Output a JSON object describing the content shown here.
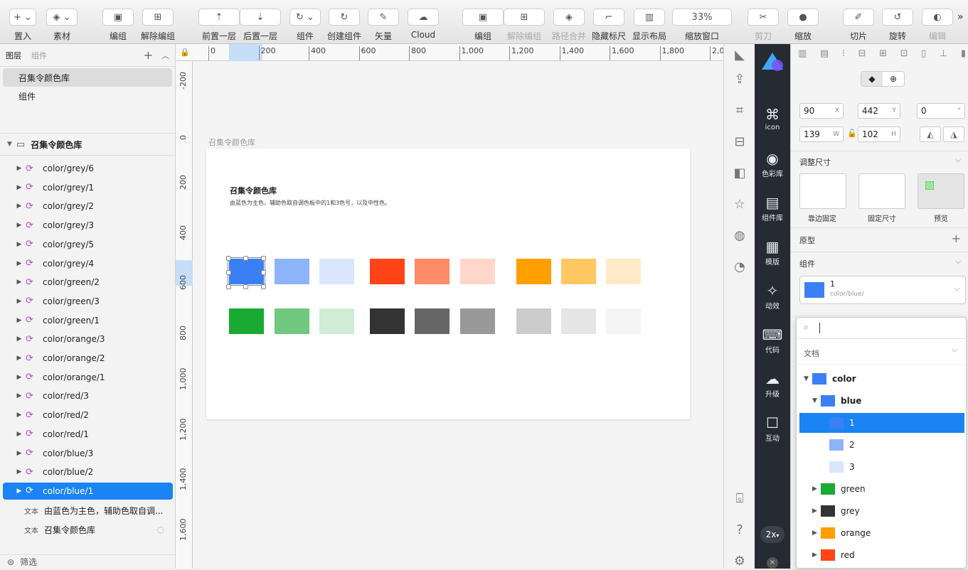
{
  "toolbar": {
    "items": [
      {
        "label": "置入",
        "icon": "+ ⌄"
      },
      {
        "label": "素材",
        "icon": "◈ ⌄"
      },
      {
        "label": "编组",
        "icon": "▣"
      },
      {
        "label": "解除编组",
        "icon": "⊞"
      },
      {
        "label": "前置一层",
        "icon": "⇡"
      },
      {
        "label": "后置一层",
        "icon": "⇣"
      },
      {
        "label": "组件",
        "icon": "↻ ⌄"
      },
      {
        "label": "创建组件",
        "icon": "↻"
      },
      {
        "label": "矢量",
        "icon": "✎"
      },
      {
        "label": "Cloud",
        "icon": "☁"
      },
      {
        "label": "编组",
        "icon": "▣"
      },
      {
        "label": "解除编组",
        "icon": "⊞"
      },
      {
        "label": "路径合并",
        "icon": "◈"
      },
      {
        "label": "隐藏标尺",
        "icon": "⌐"
      },
      {
        "label": "显示布局",
        "icon": "▥"
      },
      {
        "label": "缩放窗口",
        "icon": "33%"
      },
      {
        "label": "剪刀",
        "icon": "✂"
      },
      {
        "label": "缩放",
        "icon": "●"
      },
      {
        "label": "切片",
        "icon": "✐"
      },
      {
        "label": "旋转",
        "icon": "↺"
      },
      {
        "label": "编辑",
        "icon": "◐"
      }
    ],
    "zoom": "33%",
    "more": "»"
  },
  "layers_panel": {
    "tabs": [
      "图层",
      "组件"
    ],
    "pages": [
      "召集令颜色库",
      "组件"
    ],
    "artboard": "召集令颜色库",
    "layers": [
      "color/grey/6",
      "color/grey/1",
      "color/grey/2",
      "color/grey/3",
      "color/grey/5",
      "color/grey/4",
      "color/green/2",
      "color/green/3",
      "color/green/1",
      "color/orange/3",
      "color/orange/2",
      "color/orange/1",
      "color/red/3",
      "color/red/2",
      "color/red/1",
      "color/blue/3",
      "color/blue/2",
      "color/blue/1"
    ],
    "text_layers": [
      {
        "tag": "文本",
        "name": "由蓝色为主色，辅助色取自调..."
      },
      {
        "tag": "文本",
        "name": "召集令颜色库"
      }
    ],
    "filter": "筛选"
  },
  "ruler": {
    "h": [
      "0",
      "200",
      "400",
      "600",
      "800",
      "1,000",
      "1,200",
      "1,400",
      "1,600",
      "1,800",
      "2,0"
    ],
    "v": [
      "-200",
      "0",
      "200",
      "400",
      "600",
      "800",
      "1,000",
      "1,200",
      "1,400",
      "1,600"
    ]
  },
  "canvas": {
    "artboard_label": "召集令颜色库",
    "title": "召集令颜色库",
    "desc": "由蓝色为主色，辅助色取自调色板中的1和3色号，以及中性色。",
    "row1": [
      "#3a7ff6",
      "#8db4f9",
      "#d9e6fd",
      "#ff4517",
      "#ff8b68",
      "#ffd6ca",
      "#ff9f00",
      "#ffc863",
      "#ffebc8"
    ],
    "row2": [
      "#1aaa31",
      "#70c97e",
      "#d0ecd4",
      "#333333",
      "#666666",
      "#999999",
      "#cccccc",
      "#e5e5e5",
      "#f5f5f5"
    ]
  },
  "plugin_bar": {
    "items": [
      "icon",
      "色彩库",
      "组件库",
      "模版",
      "动效",
      "代码",
      "升级",
      "互动"
    ],
    "scale": "2x"
  },
  "inspector": {
    "x": "90",
    "y": "442",
    "r": "0",
    "w": "139",
    "h": "102",
    "units": {
      "x": "X",
      "y": "Y",
      "r": "°",
      "w": "W",
      "h": "H"
    },
    "resize_title": "调整尺寸",
    "resize_opts": [
      "靠边固定",
      "固定尺寸",
      "预览"
    ],
    "prototype": "原型",
    "component": "组件",
    "symbol_name": "1",
    "symbol_path": "color/blue/"
  },
  "popup": {
    "section": "文档",
    "tree": [
      {
        "label": "color",
        "color": "#3a7ff6",
        "level": 0,
        "open": true
      },
      {
        "label": "blue",
        "color": "#3a7ff6",
        "level": 1,
        "open": true
      },
      {
        "label": "1",
        "color": "#3a7ff6",
        "level": 2,
        "sel": true
      },
      {
        "label": "2",
        "color": "#8db4f9",
        "level": 2
      },
      {
        "label": "3",
        "color": "#d9e6fd",
        "level": 2
      },
      {
        "label": "green",
        "color": "#1aaa31",
        "level": 1
      },
      {
        "label": "grey",
        "color": "#333333",
        "level": 1
      },
      {
        "label": "orange",
        "color": "#ff9f00",
        "level": 1
      },
      {
        "label": "red",
        "color": "#ff4517",
        "level": 1
      }
    ]
  }
}
